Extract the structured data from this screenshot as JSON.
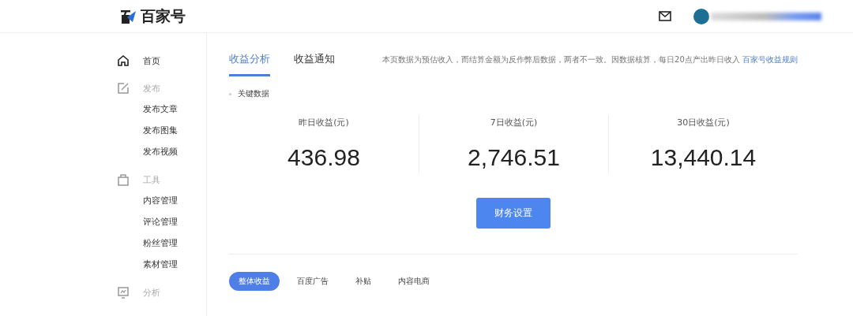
{
  "header": {
    "logo_text": "百家号"
  },
  "sidebar": {
    "items": [
      {
        "label": "首页",
        "kind": "home"
      },
      {
        "label": "发布",
        "kind": "edit",
        "children": [
          {
            "label": "发布文章"
          },
          {
            "label": "发布图集"
          },
          {
            "label": "发布视频"
          }
        ]
      },
      {
        "label": "工具",
        "kind": "bag",
        "children": [
          {
            "label": "内容管理"
          },
          {
            "label": "评论管理"
          },
          {
            "label": "粉丝管理"
          },
          {
            "label": "素材管理"
          }
        ]
      },
      {
        "label": "分析",
        "kind": "chart"
      }
    ]
  },
  "tabs": [
    {
      "label": "收益分析",
      "selected": true
    },
    {
      "label": "收益通知",
      "selected": false
    }
  ],
  "notice": {
    "text": "本页数据为预估收入，而结算金额为反作弊后数据，两者不一致。因数据核算，每日20点产出昨日收入",
    "link": "百家号收益规则"
  },
  "section_title": "关键数据",
  "stats": [
    {
      "label": "昨日收益(元)",
      "value": "436.98"
    },
    {
      "label": "7日收益(元)",
      "value": "2,746.51"
    },
    {
      "label": "30日收益(元)",
      "value": "13,440.14"
    }
  ],
  "action_button": "财务设置",
  "filters": [
    {
      "label": "整体收益",
      "selected": true
    },
    {
      "label": "百度广告",
      "selected": false
    },
    {
      "label": "补贴",
      "selected": false
    },
    {
      "label": "内容电商",
      "selected": false
    }
  ]
}
